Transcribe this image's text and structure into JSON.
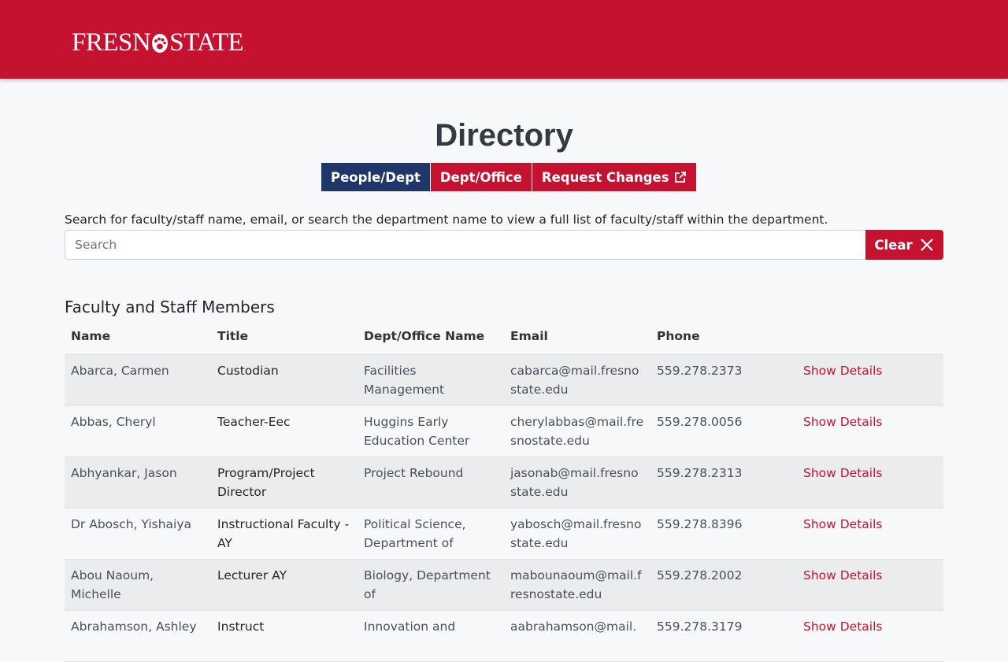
{
  "header": {
    "logo_left": "FRESN",
    "logo_right": "STATE",
    "logo_tm": "."
  },
  "page": {
    "title": "Directory",
    "help_text": "Search for faculty/staff name, email, or search the department name to view a full list of faculty/staff within the department.",
    "section_title": "Faculty and Staff Members"
  },
  "tabs": [
    {
      "label": "People/Dept",
      "active": true
    },
    {
      "label": "Dept/Office",
      "active": false
    },
    {
      "label": "Request Changes",
      "active": false
    }
  ],
  "search": {
    "placeholder": "Search",
    "value": "",
    "clear_label": "Clear"
  },
  "table": {
    "columns": [
      "Name",
      "Title",
      "Dept/Office Name",
      "Email",
      "Phone",
      ""
    ],
    "rows": [
      {
        "name": "Abarca, Carmen",
        "title": "Custodian",
        "dept": "Facilities Management",
        "email": "cabarca@mail.fresnostate.edu",
        "phone": "559.278.2373",
        "action": "Show Details"
      },
      {
        "name": "Abbas, Cheryl",
        "title": "Teacher-Eec",
        "dept": "Huggins Early Education Center",
        "email": "cherylabbas@mail.fresnostate.edu",
        "phone": "559.278.0056",
        "action": "Show Details"
      },
      {
        "name": "Abhyankar, Jason",
        "title": "Program/Project Director",
        "dept": "Project Rebound",
        "email": "jasonab@mail.fresnostate.edu",
        "phone": "559.278.2313",
        "action": "Show Details"
      },
      {
        "name": "Dr Abosch, Yishaiya",
        "title": "Instructional Faculty - AY",
        "dept": "Political Science, Department of",
        "email": "yabosch@mail.fresnostate.edu",
        "phone": "559.278.8396",
        "action": "Show Details"
      },
      {
        "name": "Abou Naoum, Michelle",
        "title": "Lecturer AY",
        "dept": "Biology, Department of",
        "email": "mabounaoum@mail.fresnostate.edu",
        "phone": "559.278.2002",
        "action": "Show Details"
      },
      {
        "name": "Abrahamson, Ashley",
        "title": "Instruct",
        "dept": "Innovation and",
        "email": "aabrahamson@mail.",
        "phone": "559.278.3179",
        "action": "Show Details"
      }
    ]
  }
}
